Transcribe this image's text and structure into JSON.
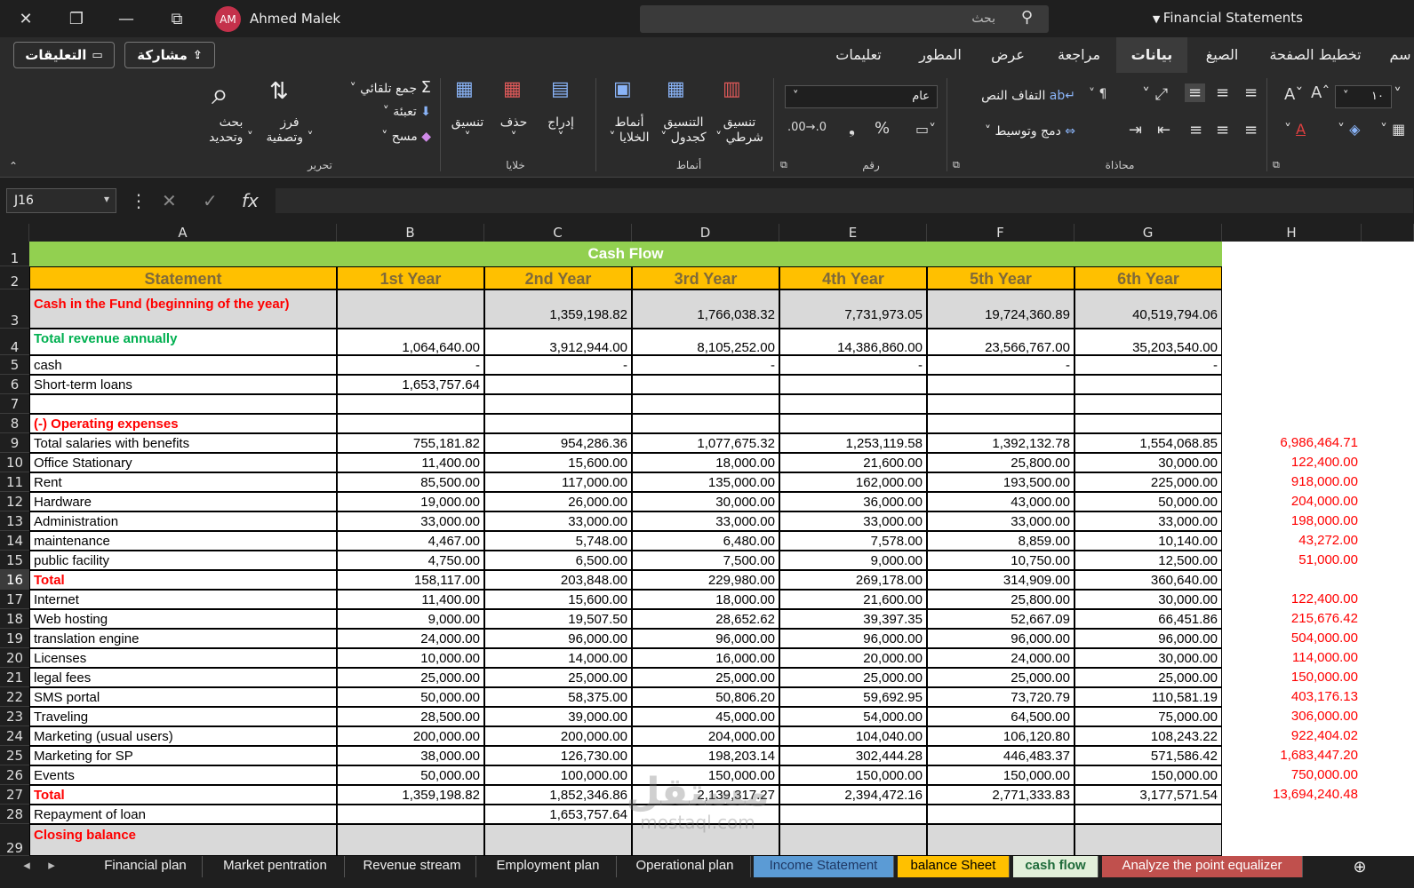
{
  "titlebar": {
    "user_initials": "AM",
    "user_name": "Ahmed Malek",
    "search_placeholder": "بحث",
    "doc_name": "Financial Statements"
  },
  "menu": {
    "comments": "التعليقات",
    "share": "مشاركة",
    "tabs": [
      "تعليمات",
      "المطور",
      "عرض",
      "مراجعة",
      "بيانات",
      "الصيغ",
      "تخطيط الصفحة",
      "سم"
    ]
  },
  "ribbon": {
    "edit": {
      "autosum": "جمع تلقائي",
      "fill": "تعبئة",
      "clear": "مسح",
      "sort": "فرز",
      "sort2": "وتصفية",
      "find": "بحث",
      "find2": "وتحديد",
      "label": "تحرير"
    },
    "cells": {
      "format": "تنسيق",
      "delete": "حذف",
      "insert": "إدراج",
      "label": "خلايا"
    },
    "styles": {
      "cell_styles": "أنماط",
      "cell_styles2": "الخلايا",
      "fmt_table": "التنسيق",
      "fmt_table2": "كجدول",
      "cond": "تنسيق",
      "cond2": "شرطي",
      "label": "أنماط"
    },
    "number": {
      "format": "عام",
      "label": "رقم"
    },
    "align": {
      "wrap": "التفاف النص",
      "merge": "دمج وتوسيط",
      "label": "محاذاة"
    },
    "font": {
      "size": "١٠"
    }
  },
  "formula_bar": {
    "cell_ref": "J16",
    "fx": "fx"
  },
  "columns": [
    "A",
    "B",
    "C",
    "D",
    "E",
    "F",
    "G",
    "H"
  ],
  "sheet": {
    "title": "Cash Flow",
    "headers": [
      "Statement",
      "1st Year",
      "2nd Year",
      "3rd Year",
      "4th Year",
      "5th Year",
      "6th Year"
    ],
    "rows": [
      {
        "n": "3",
        "label": "Cash in the Fund (beginning of the year)",
        "vals": [
          "",
          "1,359,198.82",
          "1,766,038.32",
          "7,731,973.05",
          "19,724,360.89",
          "40,519,794.06"
        ],
        "h": ""
      },
      {
        "n": "4",
        "label": "Total revenue annually",
        "vals": [
          "1,064,640.00",
          "3,912,944.00",
          "8,105,252.00",
          "14,386,860.00",
          "23,566,767.00",
          "35,203,540.00"
        ],
        "h": ""
      },
      {
        "n": "5",
        "label": "cash",
        "vals": [
          "-",
          "-",
          "-",
          "-",
          "-",
          "-"
        ],
        "h": ""
      },
      {
        "n": "6",
        "label": "Short-term loans",
        "vals": [
          "1,653,757.64",
          "",
          "",
          "",
          "",
          ""
        ],
        "h": ""
      },
      {
        "n": "7",
        "label": "",
        "vals": [
          "",
          "",
          "",
          "",
          "",
          ""
        ],
        "h": ""
      },
      {
        "n": "8",
        "label": "(-) Operating expenses",
        "vals": [
          "",
          "",
          "",
          "",
          "",
          ""
        ],
        "h": ""
      },
      {
        "n": "9",
        "label": "Total salaries with benefits",
        "vals": [
          "755,181.82",
          "954,286.36",
          "1,077,675.32",
          "1,253,119.58",
          "1,392,132.78",
          "1,554,068.85"
        ],
        "h": "6,986,464.71"
      },
      {
        "n": "10",
        "label": "Office Stationary",
        "vals": [
          "11,400.00",
          "15,600.00",
          "18,000.00",
          "21,600.00",
          "25,800.00",
          "30,000.00"
        ],
        "h": "122,400.00"
      },
      {
        "n": "11",
        "label": "Rent",
        "vals": [
          "85,500.00",
          "117,000.00",
          "135,000.00",
          "162,000.00",
          "193,500.00",
          "225,000.00"
        ],
        "h": "918,000.00"
      },
      {
        "n": "12",
        "label": "Hardware",
        "vals": [
          "19,000.00",
          "26,000.00",
          "30,000.00",
          "36,000.00",
          "43,000.00",
          "50,000.00"
        ],
        "h": "204,000.00"
      },
      {
        "n": "13",
        "label": "Administration",
        "vals": [
          "33,000.00",
          "33,000.00",
          "33,000.00",
          "33,000.00",
          "33,000.00",
          "33,000.00"
        ],
        "h": "198,000.00"
      },
      {
        "n": "14",
        "label": "maintenance",
        "vals": [
          "4,467.00",
          "5,748.00",
          "6,480.00",
          "7,578.00",
          "8,859.00",
          "10,140.00"
        ],
        "h": "43,272.00"
      },
      {
        "n": "15",
        "label": "public facility",
        "vals": [
          "4,750.00",
          "6,500.00",
          "7,500.00",
          "9,000.00",
          "10,750.00",
          "12,500.00"
        ],
        "h": "51,000.00"
      },
      {
        "n": "16",
        "label": "Total",
        "vals": [
          "158,117.00",
          "203,848.00",
          "229,980.00",
          "269,178.00",
          "314,909.00",
          "360,640.00"
        ],
        "h": ""
      },
      {
        "n": "17",
        "label": "Internet",
        "vals": [
          "11,400.00",
          "15,600.00",
          "18,000.00",
          "21,600.00",
          "25,800.00",
          "30,000.00"
        ],
        "h": "122,400.00"
      },
      {
        "n": "18",
        "label": "Web hosting",
        "vals": [
          "9,000.00",
          "19,507.50",
          "28,652.62",
          "39,397.35",
          "52,667.09",
          "66,451.86"
        ],
        "h": "215,676.42"
      },
      {
        "n": "19",
        "label": "translation engine",
        "vals": [
          "24,000.00",
          "96,000.00",
          "96,000.00",
          "96,000.00",
          "96,000.00",
          "96,000.00"
        ],
        "h": "504,000.00"
      },
      {
        "n": "20",
        "label": "Licenses",
        "vals": [
          "10,000.00",
          "14,000.00",
          "16,000.00",
          "20,000.00",
          "24,000.00",
          "30,000.00"
        ],
        "h": "114,000.00"
      },
      {
        "n": "21",
        "label": "legal fees",
        "vals": [
          "25,000.00",
          "25,000.00",
          "25,000.00",
          "25,000.00",
          "25,000.00",
          "25,000.00"
        ],
        "h": "150,000.00"
      },
      {
        "n": "22",
        "label": "SMS portal",
        "vals": [
          "50,000.00",
          "58,375.00",
          "50,806.20",
          "59,692.95",
          "73,720.79",
          "110,581.19"
        ],
        "h": "403,176.13"
      },
      {
        "n": "23",
        "label": "Traveling",
        "vals": [
          "28,500.00",
          "39,000.00",
          "45,000.00",
          "54,000.00",
          "64,500.00",
          "75,000.00"
        ],
        "h": "306,000.00"
      },
      {
        "n": "24",
        "label": "Marketing (usual users)",
        "vals": [
          "200,000.00",
          "200,000.00",
          "204,000.00",
          "104,040.00",
          "106,120.80",
          "108,243.22"
        ],
        "h": "922,404.02"
      },
      {
        "n": "25",
        "label": "Marketing for SP",
        "vals": [
          "38,000.00",
          "126,730.00",
          "198,203.14",
          "302,444.28",
          "446,483.37",
          "571,586.42"
        ],
        "h": "1,683,447.20"
      },
      {
        "n": "26",
        "label": "Events",
        "vals": [
          "50,000.00",
          "100,000.00",
          "150,000.00",
          "150,000.00",
          "150,000.00",
          "150,000.00"
        ],
        "h": "750,000.00"
      },
      {
        "n": "27",
        "label": "Total",
        "vals": [
          "1,359,198.82",
          "1,852,346.86",
          "2,139,317.27",
          "2,394,472.16",
          "2,771,333.83",
          "3,177,571.54"
        ],
        "h": "13,694,240.48"
      },
      {
        "n": "28",
        "label": "Repayment of loan",
        "vals": [
          "",
          "1,653,757.64",
          "",
          "",
          "",
          ""
        ],
        "h": ""
      },
      {
        "n": "29",
        "label": "Closing balance",
        "vals": [
          "",
          "",
          "",
          "",
          "",
          ""
        ],
        "h": ""
      }
    ]
  },
  "watermark": {
    "text": "مستقل",
    "sub": "mostaql.com"
  },
  "sheet_tabs": [
    "Financial plan",
    "Market pentration",
    "Revenue stream",
    "Employment plan",
    "Operational plan",
    "Income Statement",
    "balance Sheet",
    "cash flow",
    "Analyze the point equalizer"
  ]
}
